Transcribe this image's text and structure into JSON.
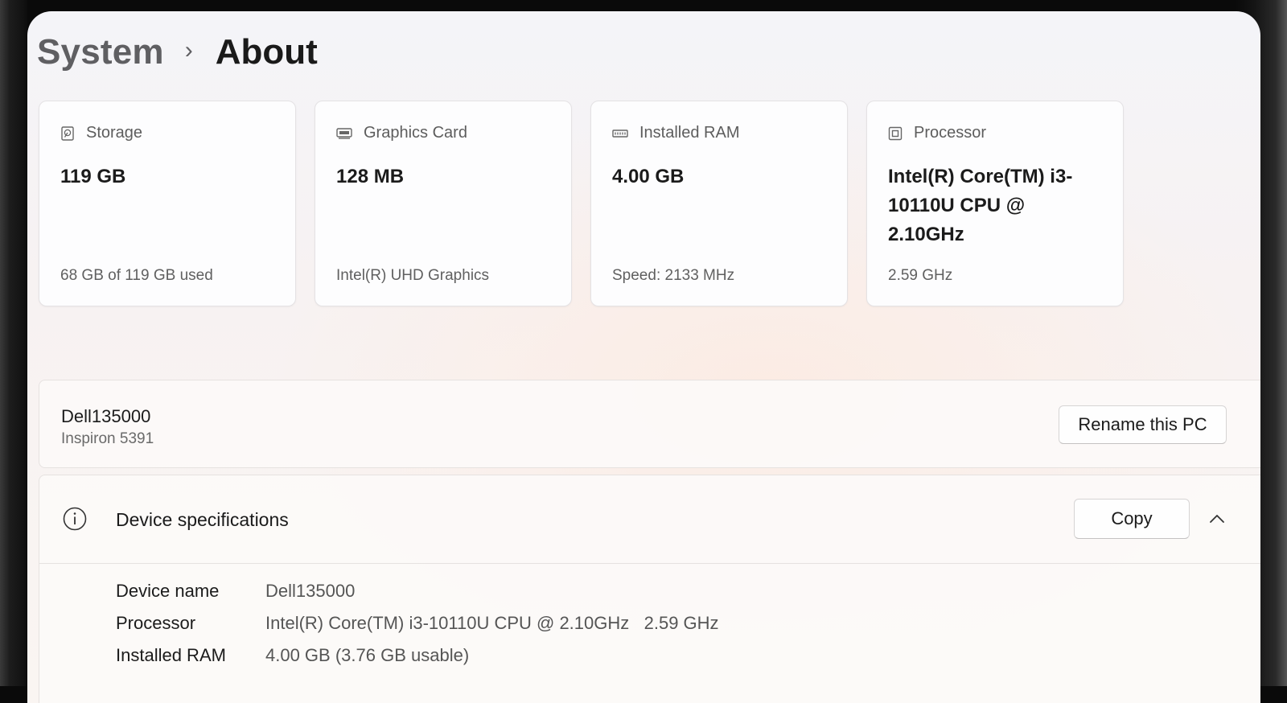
{
  "breadcrumb": {
    "parent": "System",
    "separator": "›",
    "current": "About"
  },
  "cards": [
    {
      "icon": "storage-icon",
      "label": "Storage",
      "value": "119 GB",
      "sub": "68 GB of 119 GB used"
    },
    {
      "icon": "graphics-card-icon",
      "label": "Graphics Card",
      "value": "128 MB",
      "sub": "Intel(R) UHD Graphics"
    },
    {
      "icon": "ram-icon",
      "label": "Installed RAM",
      "value": "4.00 GB",
      "sub": "Speed: 2133 MHz"
    },
    {
      "icon": "processor-icon",
      "label": "Processor",
      "value": "Intel(R) Core(TM) i3-10110U CPU @ 2.10GHz",
      "sub": "2.59 GHz"
    }
  ],
  "pc": {
    "name": "Dell135000",
    "model": "Inspiron 5391",
    "rename_label": "Rename this PC"
  },
  "specs": {
    "title": "Device specifications",
    "copy_label": "Copy",
    "icon": "info-icon",
    "collapse_icon": "chevron-up-icon",
    "rows": [
      {
        "label": "Device name",
        "value": "Dell135000"
      },
      {
        "label": "Processor",
        "value": "Intel(R) Core(TM) i3-10110U CPU @ 2.10GHz   2.59 GHz"
      },
      {
        "label": "Installed RAM",
        "value": "4.00 GB (3.76 GB usable)"
      }
    ]
  }
}
